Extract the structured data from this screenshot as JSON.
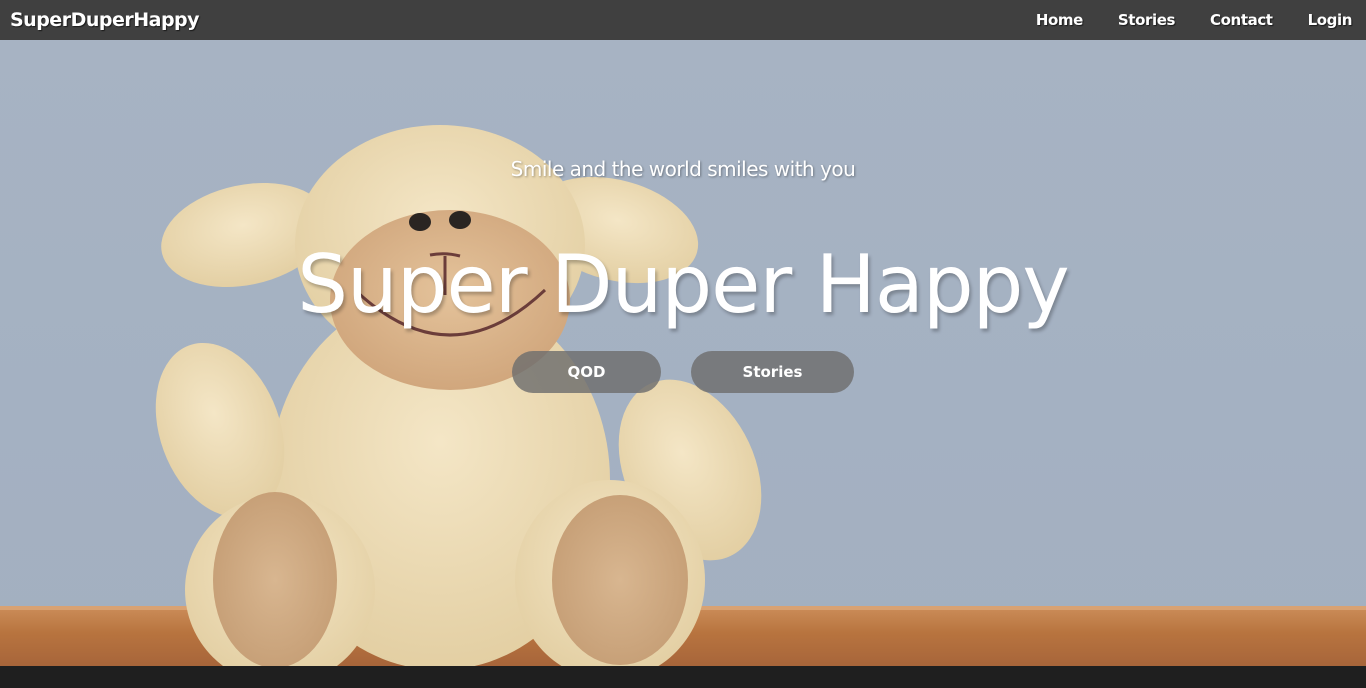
{
  "navbar": {
    "brand": "SuperDuperHappy",
    "links": [
      {
        "label": "Home"
      },
      {
        "label": "Stories"
      },
      {
        "label": "Contact"
      },
      {
        "label": "Login"
      }
    ]
  },
  "hero": {
    "tagline": "Smile and the world smiles with you",
    "title": "Super Duper Happy",
    "buttons": {
      "qod": "QOD",
      "stories": "Stories"
    }
  },
  "colors": {
    "navbar_bg": "#404040",
    "wall": "#a7b3c3",
    "floor": "#b8743f",
    "button_bg": "#6e6e6e",
    "footer": "#1f1f1f"
  }
}
